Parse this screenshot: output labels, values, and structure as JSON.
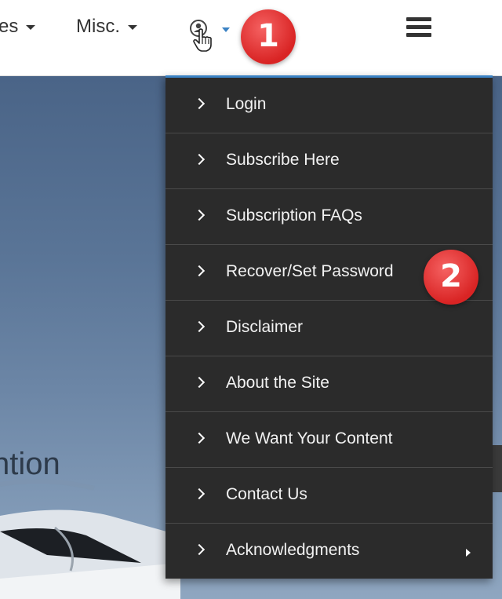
{
  "navbar": {
    "partial_item_label": "es",
    "misc_label": "Misc.",
    "user_icon": "user-circle-icon",
    "hand_cursor_icon": "hand-pointer-icon",
    "hamburger_icon": "hamburger-menu-icon"
  },
  "badges": {
    "first": "1",
    "second": "2"
  },
  "hero": {
    "partial_text": "ntion"
  },
  "menu": {
    "items": [
      {
        "label": "Login"
      },
      {
        "label": "Subscribe Here"
      },
      {
        "label": "Subscription FAQs"
      },
      {
        "label": "Recover/Set Password"
      },
      {
        "label": "Disclaimer"
      },
      {
        "label": "About the Site"
      },
      {
        "label": "We Want Your Content"
      },
      {
        "label": "Contact Us"
      },
      {
        "label": "Acknowledgments",
        "has_submenu": true
      }
    ]
  },
  "colors": {
    "accent": "#3b82c4",
    "menu_bg": "#2b2b2b",
    "badge": "#d92424"
  }
}
